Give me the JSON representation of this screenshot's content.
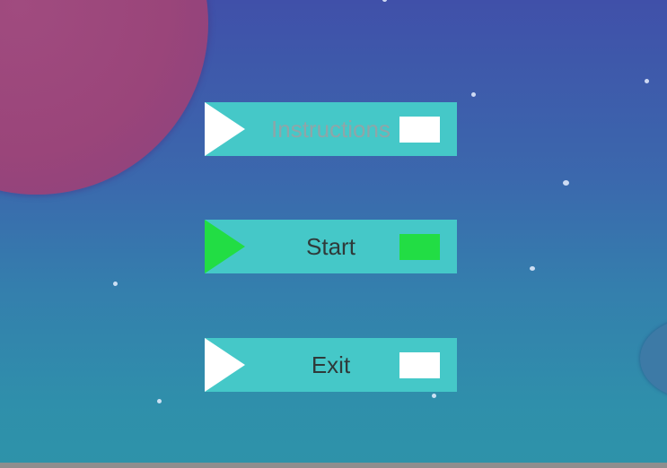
{
  "menu": {
    "buttons": [
      {
        "label": "Instructions",
        "selected": false,
        "dimmed": true
      },
      {
        "label": "Start",
        "selected": true,
        "dimmed": false
      },
      {
        "label": "Exit",
        "selected": false,
        "dimmed": false
      }
    ]
  },
  "colors": {
    "button_background": "#45c8c8",
    "selection_highlight": "#22dd44",
    "arrow_default": "#ffffff",
    "text_default": "#2f3a3a",
    "text_dimmed": "#8fa5a8",
    "sky_top": "#4050a9",
    "sky_bottom": "#2e93a9",
    "planet": "#9a457a"
  },
  "icons": {
    "arrow": "play-triangle-icon",
    "indicator": "selection-box-icon"
  }
}
